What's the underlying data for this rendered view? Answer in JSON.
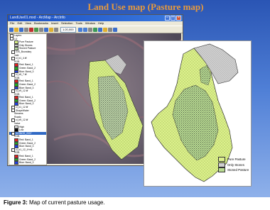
{
  "slide": {
    "title": "Land Use map (Pasture map)"
  },
  "window": {
    "title": "LandUse01.mxd - ArcMap - ArcInfo",
    "menu": [
      "File",
      "Edit",
      "View",
      "Bookmarks",
      "Insert",
      "Selection",
      "Tools",
      "Window",
      "Help"
    ],
    "scale": "1:20,000"
  },
  "toc": {
    "items": [
      {
        "label": "Layers",
        "kind": "group"
      },
      {
        "label": "LU",
        "kind": "group"
      },
      {
        "label": "Pure Pasture",
        "kind": "legend",
        "color": "#d8ef86"
      },
      {
        "label": "Only Stones",
        "kind": "legend",
        "color": "#c9c9c9"
      },
      {
        "label": "Stoned Pasture",
        "kind": "legend",
        "color": "#b7d8a0"
      },
      {
        "label": "GIS_Boundary",
        "kind": "layer"
      },
      {
        "label": "Vale",
        "kind": "sub"
      },
      {
        "label": "cl_b1_4.tif",
        "kind": "layer"
      },
      {
        "label": "RGB",
        "kind": "sub"
      },
      {
        "label": "Red: Band_1",
        "kind": "band",
        "color": "#e02020"
      },
      {
        "label": "Green: Band_2",
        "kind": "band",
        "color": "#20b020"
      },
      {
        "label": "Blue: Band_3",
        "kind": "band",
        "color": "#2040e0"
      },
      {
        "label": "cl_b5_7.tif",
        "kind": "layer"
      },
      {
        "label": "RGB",
        "kind": "sub"
      },
      {
        "label": "Red: Band_1",
        "kind": "band",
        "color": "#e02020"
      },
      {
        "label": "Green: Band_2",
        "kind": "band",
        "color": "#20b020"
      },
      {
        "label": "Blue: Band_3",
        "kind": "band",
        "color": "#2040e0"
      },
      {
        "label": "cl_b9_12.tif",
        "kind": "layer"
      },
      {
        "label": "RGB",
        "kind": "sub"
      },
      {
        "label": "Red: Band_1",
        "kind": "band",
        "color": "#e02020"
      },
      {
        "label": "Green: Band_2",
        "kind": "band",
        "color": "#20b020"
      },
      {
        "label": "Blue: Band_3",
        "kind": "band",
        "color": "#2040e0"
      },
      {
        "label": "cl_b1_12.tif",
        "kind": "layer"
      },
      {
        "label": "ShapeWater",
        "kind": "layer"
      },
      {
        "label": "Streams",
        "kind": "sub"
      },
      {
        "label": "Roads",
        "kind": "sub"
      },
      {
        "label": "cl_b9_12.tif",
        "kind": "layer"
      },
      {
        "label": "Value",
        "kind": "sub"
      },
      {
        "label": "High",
        "kind": "band",
        "color": "#ffffff"
      },
      {
        "label": "Low",
        "kind": "band",
        "color": "#000000"
      },
      {
        "label": "IKONOS_2007",
        "kind": "layer",
        "selected": true
      },
      {
        "label": "RGB",
        "kind": "sub"
      },
      {
        "label": "Red: Band_1",
        "kind": "band",
        "color": "#e02020"
      },
      {
        "label": "Green: Band_2",
        "kind": "band",
        "color": "#20b020"
      },
      {
        "label": "Blue: Band_3",
        "kind": "band",
        "color": "#2040e0"
      },
      {
        "label": "cl_b1_12_4+n6...",
        "kind": "layer"
      },
      {
        "label": "RGB",
        "kind": "sub"
      },
      {
        "label": "Red: Band_1",
        "kind": "band",
        "color": "#e02020"
      },
      {
        "label": "Green: Band_2",
        "kind": "band",
        "color": "#20b020"
      },
      {
        "label": "Blue: Band_3",
        "kind": "band",
        "color": "#2040e0"
      }
    ]
  },
  "legend": {
    "items": [
      {
        "label": "Pure Pasture",
        "color": "#dcf08c"
      },
      {
        "label": "Only Stones",
        "color": "#cfcfcf"
      },
      {
        "label": "Stoned Pasture",
        "color": "#b9db92"
      }
    ]
  },
  "caption": {
    "label": "Figure 3:",
    "text": " Map of current pasture usage."
  }
}
